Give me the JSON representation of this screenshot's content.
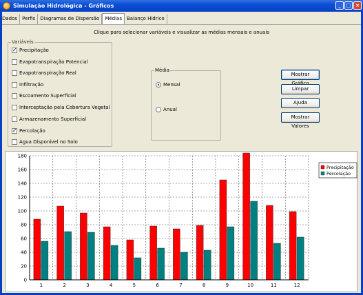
{
  "window": {
    "title": "Simulação Hidrológica - Gráficos"
  },
  "tabs": [
    "Dados",
    "Perfis",
    "Diagramas de Dispersão",
    "Médias",
    "Balanço Hídrico"
  ],
  "instruction": "Clique para selecionar variáveis e visualizar as médias mensais e anuais",
  "variables": {
    "legend": "Variáveis",
    "items": [
      {
        "label": "Precipitação",
        "checked": true
      },
      {
        "label": "Evapotranspiração Potencial",
        "checked": false
      },
      {
        "label": "Evapotranspiração Real",
        "checked": false
      },
      {
        "label": "Infiltração",
        "checked": false
      },
      {
        "label": "Escoamento Superficial",
        "checked": false
      },
      {
        "label": "Interceptação pela Cobertura Vegetal",
        "checked": false
      },
      {
        "label": "Armazenamento Superficial",
        "checked": false
      },
      {
        "label": "Percolação",
        "checked": true
      },
      {
        "label": "Água Disponível no Solo",
        "checked": false
      }
    ]
  },
  "media": {
    "legend": "Média",
    "options": [
      {
        "label": "Mensal",
        "selected": true
      },
      {
        "label": "Anual",
        "selected": false
      }
    ]
  },
  "buttons": {
    "mostrar_grafico": "Mostrar Gráfico",
    "limpar": "Limpar",
    "ajuda": "Ajuda",
    "mostrar_valores": "Mostrar Valores"
  },
  "chart_data": {
    "type": "bar",
    "categories": [
      "1",
      "2",
      "3",
      "4",
      "5",
      "6",
      "7",
      "8",
      "9",
      "10",
      "11",
      "12"
    ],
    "series": [
      {
        "name": "Precipitação",
        "color": "#ff0000",
        "values": [
          88,
          107,
          97,
          77,
          58,
          78,
          74,
          79,
          145,
          184,
          108,
          99
        ]
      },
      {
        "name": "Percolação",
        "color": "#008080",
        "values": [
          56,
          70,
          69,
          50,
          32,
          46,
          40,
          43,
          77,
          114,
          53,
          62
        ]
      }
    ],
    "ylim": [
      0,
      180
    ],
    "yticks": [
      0,
      20,
      40,
      60,
      80,
      100,
      120,
      140,
      160,
      180
    ],
    "grid": true,
    "legend_position": "top-right"
  }
}
